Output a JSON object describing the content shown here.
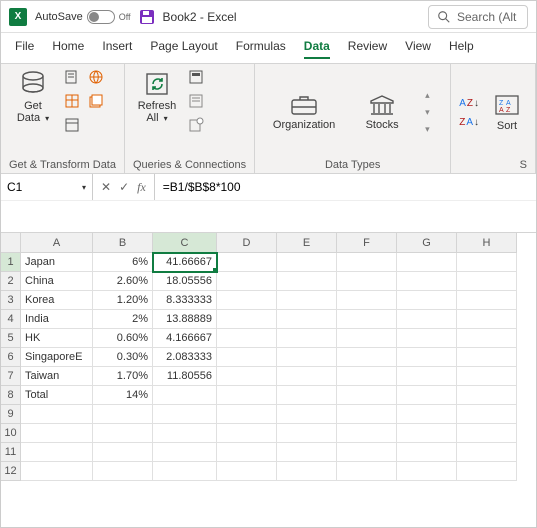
{
  "titlebar": {
    "autosave_label": "AutoSave",
    "autosave_state": "Off",
    "doc_title": "Book2  -  Excel",
    "search_placeholder": "Search (Alt"
  },
  "menus": [
    "File",
    "Home",
    "Insert",
    "Page Layout",
    "Formulas",
    "Data",
    "Review",
    "View",
    "Help"
  ],
  "active_menu": "Data",
  "ribbon": {
    "group1": {
      "getdata": "Get\nData",
      "label": "Get & Transform Data"
    },
    "group2": {
      "refresh": "Refresh\nAll",
      "label": "Queries & Connections"
    },
    "group3": {
      "org": "Organization",
      "stocks": "Stocks",
      "label": "Data Types"
    },
    "group4": {
      "sort": "Sort",
      "label": "S"
    }
  },
  "namebox": "C1",
  "formula": "=B1/$B$8*100",
  "columns": [
    "A",
    "B",
    "C",
    "D",
    "E",
    "F",
    "G",
    "H"
  ],
  "rows": [
    {
      "n": "1",
      "a": "Japan",
      "b": "6%",
      "c": "41.66667"
    },
    {
      "n": "2",
      "a": "China",
      "b": "2.60%",
      "c": "18.05556"
    },
    {
      "n": "3",
      "a": "Korea",
      "b": "1.20%",
      "c": "8.333333"
    },
    {
      "n": "4",
      "a": "India",
      "b": "2%",
      "c": "13.88889"
    },
    {
      "n": "5",
      "a": "HK",
      "b": "0.60%",
      "c": "4.166667"
    },
    {
      "n": "6",
      "a": "SingaporeE",
      "b": "0.30%",
      "c": "2.083333"
    },
    {
      "n": "7",
      "a": "Taiwan",
      "b": "1.70%",
      "c": "11.80556"
    },
    {
      "n": "8",
      "a": "Total",
      "b": "14%",
      "c": ""
    },
    {
      "n": "9",
      "a": "",
      "b": "",
      "c": ""
    },
    {
      "n": "10",
      "a": "",
      "b": "",
      "c": ""
    },
    {
      "n": "11",
      "a": "",
      "b": "",
      "c": ""
    },
    {
      "n": "12",
      "a": "",
      "b": "",
      "c": ""
    }
  ],
  "selected_cell": "C1"
}
